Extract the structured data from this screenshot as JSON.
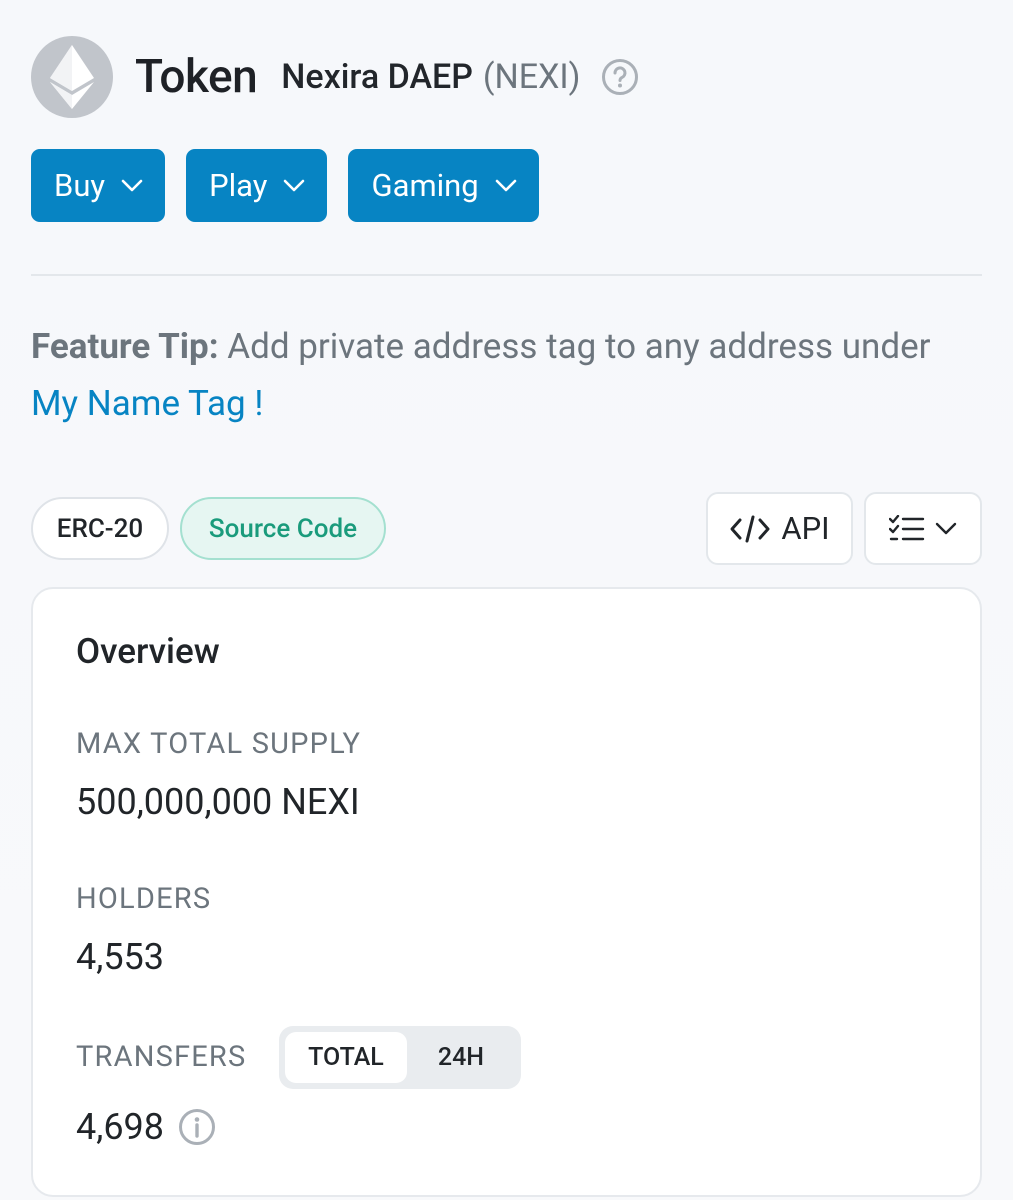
{
  "header": {
    "title": "Token",
    "token_name": "Nexira DAEP",
    "token_symbol": "(NEXI)",
    "logo_icon": "ethereum-icon",
    "help_icon": "question-circle-icon"
  },
  "buttons": [
    {
      "label": "Buy"
    },
    {
      "label": "Play"
    },
    {
      "label": "Gaming"
    }
  ],
  "feature_tip": {
    "label": "Feature Tip:",
    "text": " Add private address tag to any address under ",
    "link": "My Name Tag !"
  },
  "tags": {
    "standard": "ERC-20",
    "source_code": "Source Code"
  },
  "actions": {
    "api_label": "API",
    "api_icon": "code-icon",
    "list_icon": "checklist-icon"
  },
  "overview": {
    "title": "Overview",
    "max_supply_label": "MAX TOTAL SUPPLY",
    "max_supply_value": "500,000,000 NEXI",
    "holders_label": "HOLDERS",
    "holders_value": "4,553",
    "transfers_label": "TRANSFERS",
    "transfers_value": "4,698",
    "toggle": {
      "active": "TOTAL",
      "inactive": "24H"
    }
  },
  "colors": {
    "primary": "#0784c3",
    "accent_green": "#1a9b7c",
    "muted": "#6c757d"
  }
}
